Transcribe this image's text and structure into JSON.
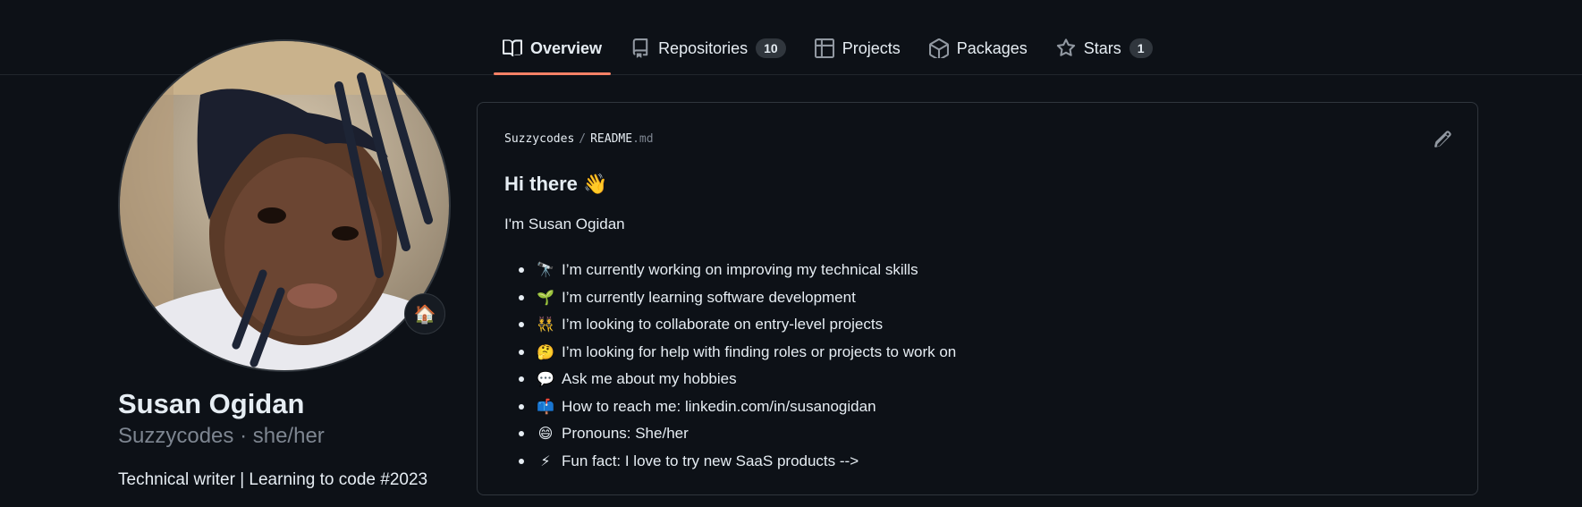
{
  "tabs": [
    {
      "label": "Overview",
      "icon": "book-icon",
      "active": true
    },
    {
      "label": "Repositories",
      "icon": "repo-icon",
      "count": "10"
    },
    {
      "label": "Projects",
      "icon": "table-icon"
    },
    {
      "label": "Packages",
      "icon": "package-icon"
    },
    {
      "label": "Stars",
      "icon": "star-icon",
      "count": "1"
    }
  ],
  "profile": {
    "name": "Susan Ogidan",
    "username_line": "Suzzycodes · she/her",
    "bio": "Technical writer | Learning to code #2023",
    "status_emoji": "🏠"
  },
  "readme": {
    "owner": "Suzzycodes",
    "separator": "/",
    "file": "README",
    "ext": ".md",
    "heading": "Hi there 👋",
    "intro": "I'm Susan Ogidan",
    "items": [
      {
        "emoji": "🔭",
        "text": "I’m currently working on improving my technical skills"
      },
      {
        "emoji": "🌱",
        "text": "I’m currently learning software development"
      },
      {
        "emoji": "👯",
        "text": "I’m looking to collaborate on entry-level projects"
      },
      {
        "emoji": "🤔",
        "text": "I’m looking for help with finding roles or projects to work on"
      },
      {
        "emoji": "💬",
        "text": "Ask me about my hobbies"
      },
      {
        "emoji": "📫",
        "text": "How to reach me: linkedin.com/in/susanogidan"
      },
      {
        "emoji": "😄",
        "text": "Pronouns: She/her"
      },
      {
        "emoji": "⚡",
        "text": "Fun fact: I love to try new SaaS products -->"
      }
    ]
  },
  "colors": {
    "background": "#0d1117",
    "accent": "#f78166",
    "muted": "#7d8590",
    "border": "#30363d"
  }
}
